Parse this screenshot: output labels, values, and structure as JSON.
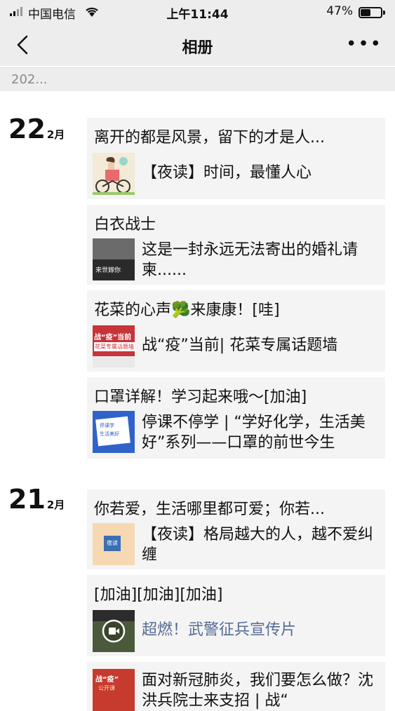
{
  "status_bar": {
    "carrier": "中国电信",
    "time": "上午11:44",
    "battery": "47%",
    "battery_level": 0.47
  },
  "nav": {
    "title": "相册",
    "back_icon": "chevron-left-icon",
    "more_label": "•••"
  },
  "year_label": "202...",
  "days": [
    {
      "day": "22",
      "month": "2月",
      "posts": [
        {
          "caption": "离开的都是风景，留下的才是人...",
          "link_title": "【夜读】时间，最懂人心",
          "thumb": "cyclist-illustration"
        },
        {
          "caption": "白衣战士",
          "link_title": "这是一封永远无法寄出的婚礼请柬......",
          "thumb_text": "来世嫁你"
        },
        {
          "caption": "花菜的心声🥦来康康！[哇]",
          "link_title": "战“疫”当前| 花菜专属话题墙",
          "thumb_text_1": "战“疫”当前",
          "thumb_text_2": "花菜专属话题墙"
        },
        {
          "caption": "口罩详解！学习起来哦～[加油]",
          "link_title": "停课不停学 | “学好化学，生活美好”系列——口罩的前世今生",
          "thumb_text_1": "停课学",
          "thumb_text_2": "生活美好"
        }
      ]
    },
    {
      "day": "21",
      "month": "2月",
      "posts": [
        {
          "caption": "你若爱，生活哪里都可爱；你若...",
          "link_title": "【夜读】格局越大的人，越不爱纠缠",
          "thumb_text": "夜读"
        },
        {
          "caption": "[加油][加油][加油]",
          "link_title": "超燃！武警征兵宣传片",
          "thumb": "video-play-icon"
        },
        {
          "caption": "",
          "link_title": "面对新冠肺炎，我们要怎么做？沈洪兵院士来支招 | 战“",
          "thumb_text_1": "战“疫”",
          "thumb_text_2": "公开课"
        }
      ]
    }
  ]
}
